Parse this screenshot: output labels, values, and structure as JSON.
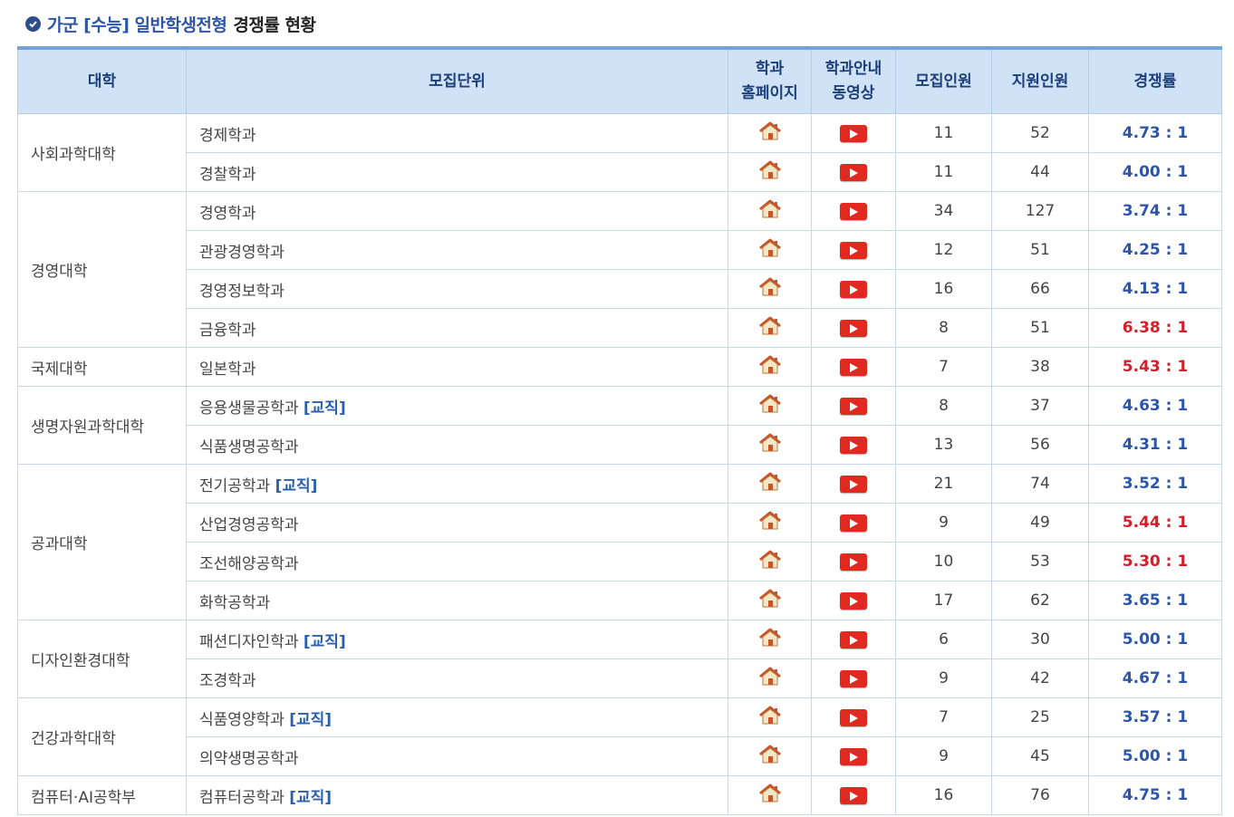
{
  "title": {
    "part1": "가군 [수능] 일반학생전형",
    "part2": "경쟁률 현황"
  },
  "headers": {
    "college": "대학",
    "unit": "모집단위",
    "homepage_l1": "학과",
    "homepage_l2": "홈페이지",
    "video_l1": "학과안내",
    "video_l2": "동영상",
    "quota": "모집인원",
    "applicants": "지원인원",
    "rate": "경쟁률"
  },
  "colors": {
    "rate_normal": "#2e56a8",
    "rate_high": "#d41e2a",
    "header_bg": "#cfe2f6"
  },
  "icons": {
    "homepage": "home-icon",
    "video": "video-play-icon"
  },
  "rows": [
    {
      "college": "사회과학대학",
      "span": 2,
      "unit": "경제학과",
      "tag": "",
      "quota": "11",
      "applicants": "52",
      "rate": "4.73 : 1",
      "high": false
    },
    {
      "unit": "경찰학과",
      "tag": "",
      "quota": "11",
      "applicants": "44",
      "rate": "4.00 : 1",
      "high": false
    },
    {
      "college": "경영대학",
      "span": 4,
      "unit": "경영학과",
      "tag": "",
      "quota": "34",
      "applicants": "127",
      "rate": "3.74 : 1",
      "high": false
    },
    {
      "unit": "관광경영학과",
      "tag": "",
      "quota": "12",
      "applicants": "51",
      "rate": "4.25 : 1",
      "high": false
    },
    {
      "unit": "경영정보학과",
      "tag": "",
      "quota": "16",
      "applicants": "66",
      "rate": "4.13 : 1",
      "high": false
    },
    {
      "unit": "금융학과",
      "tag": "",
      "quota": "8",
      "applicants": "51",
      "rate": "6.38 : 1",
      "high": true
    },
    {
      "college": "국제대학",
      "span": 1,
      "unit": "일본학과",
      "tag": "",
      "quota": "7",
      "applicants": "38",
      "rate": "5.43 : 1",
      "high": true
    },
    {
      "college": "생명자원과학대학",
      "span": 2,
      "unit": "응용생물공학과",
      "tag": "[교직]",
      "quota": "8",
      "applicants": "37",
      "rate": "4.63 : 1",
      "high": false
    },
    {
      "unit": "식품생명공학과",
      "tag": "",
      "quota": "13",
      "applicants": "56",
      "rate": "4.31 : 1",
      "high": false
    },
    {
      "college": "공과대학",
      "span": 4,
      "unit": "전기공학과",
      "tag": "[교직]",
      "quota": "21",
      "applicants": "74",
      "rate": "3.52 : 1",
      "high": false
    },
    {
      "unit": "산업경영공학과",
      "tag": "",
      "quota": "9",
      "applicants": "49",
      "rate": "5.44 : 1",
      "high": true
    },
    {
      "unit": "조선해양공학과",
      "tag": "",
      "quota": "10",
      "applicants": "53",
      "rate": "5.30 : 1",
      "high": true
    },
    {
      "unit": "화학공학과",
      "tag": "",
      "quota": "17",
      "applicants": "62",
      "rate": "3.65 : 1",
      "high": false
    },
    {
      "college": "디자인환경대학",
      "span": 2,
      "unit": "패션디자인학과",
      "tag": "[교직]",
      "quota": "6",
      "applicants": "30",
      "rate": "5.00 : 1",
      "high": false
    },
    {
      "unit": "조경학과",
      "tag": "",
      "quota": "9",
      "applicants": "42",
      "rate": "4.67 : 1",
      "high": false
    },
    {
      "college": "건강과학대학",
      "span": 2,
      "unit": "식품영양학과",
      "tag": "[교직]",
      "quota": "7",
      "applicants": "25",
      "rate": "3.57 : 1",
      "high": false
    },
    {
      "unit": "의약생명공학과",
      "tag": "",
      "quota": "9",
      "applicants": "45",
      "rate": "5.00 : 1",
      "high": false
    },
    {
      "college": "컴퓨터·AI공학부",
      "span": 1,
      "unit": "컴퓨터공학과",
      "tag": "[교직]",
      "quota": "16",
      "applicants": "76",
      "rate": "4.75 : 1",
      "high": false
    }
  ]
}
